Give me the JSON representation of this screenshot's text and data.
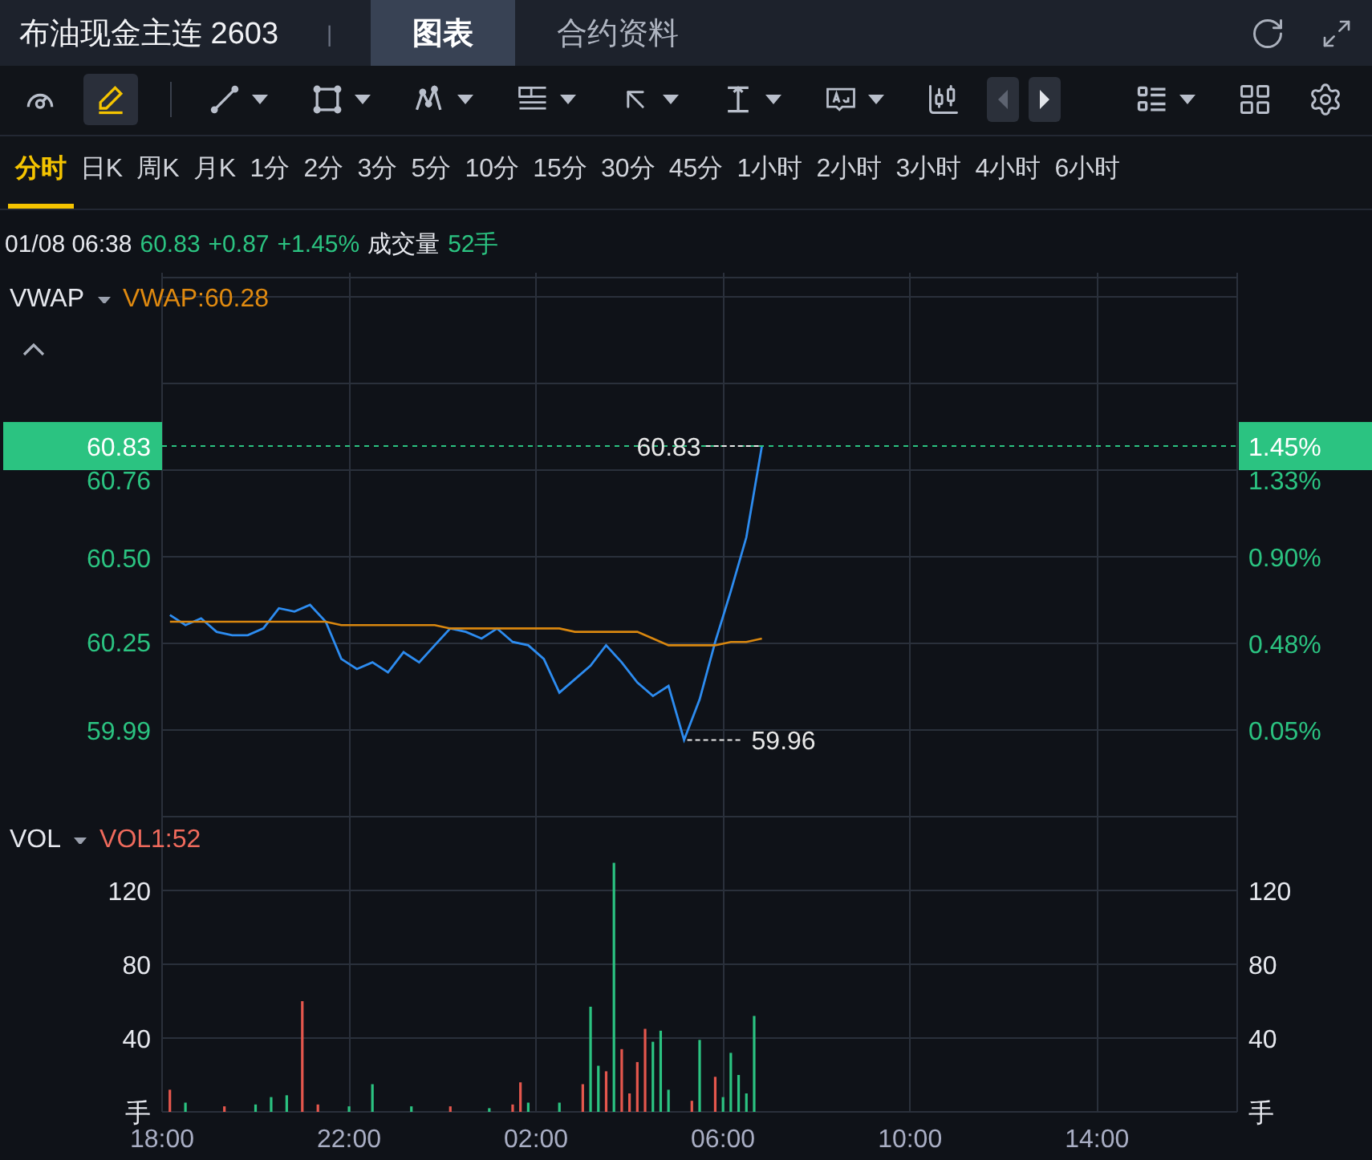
{
  "header": {
    "title": "布油现金主连 2603",
    "separator": "|",
    "tabs": [
      {
        "label": "图表",
        "selected": true
      },
      {
        "label": "合约资料",
        "selected": false
      }
    ]
  },
  "toolbar": {
    "tools": [
      {
        "kind": "gauge",
        "selected": false,
        "dropdown": false
      },
      {
        "kind": "pencil",
        "selected": true,
        "dropdown": false
      },
      {
        "kind": "divider"
      },
      {
        "kind": "line",
        "selected": false,
        "dropdown": true
      },
      {
        "kind": "rectangle",
        "selected": false,
        "dropdown": true
      },
      {
        "kind": "pattern",
        "selected": false,
        "dropdown": true
      },
      {
        "kind": "fib",
        "selected": false,
        "dropdown": true
      },
      {
        "kind": "arrow",
        "selected": false,
        "dropdown": true
      },
      {
        "kind": "measure",
        "selected": false,
        "dropdown": true
      },
      {
        "kind": "textbox",
        "selected": false,
        "dropdown": true
      },
      {
        "kind": "candles",
        "selected": false,
        "dropdown": false
      },
      {
        "kind": "prev",
        "disabled": true
      },
      {
        "kind": "next",
        "disabled": false
      },
      {
        "kind": "spacer"
      },
      {
        "kind": "layout",
        "selected": false,
        "dropdown": true
      },
      {
        "kind": "grid",
        "selected": false,
        "dropdown": false
      },
      {
        "kind": "settings",
        "selected": false,
        "dropdown": false
      }
    ]
  },
  "periods": [
    {
      "label": "分时",
      "selected": true
    },
    {
      "label": "日K",
      "selected": false
    },
    {
      "label": "周K",
      "selected": false
    },
    {
      "label": "月K",
      "selected": false
    },
    {
      "label": "1分",
      "selected": false
    },
    {
      "label": "2分",
      "selected": false
    },
    {
      "label": "3分",
      "selected": false
    },
    {
      "label": "5分",
      "selected": false
    },
    {
      "label": "10分",
      "selected": false
    },
    {
      "label": "15分",
      "selected": false
    },
    {
      "label": "30分",
      "selected": false
    },
    {
      "label": "45分",
      "selected": false
    },
    {
      "label": "1小时",
      "selected": false
    },
    {
      "label": "2小时",
      "selected": false
    },
    {
      "label": "3小时",
      "selected": false
    },
    {
      "label": "4小时",
      "selected": false
    },
    {
      "label": "6小时",
      "selected": false
    }
  ],
  "quote": {
    "time": "01/08 06:38",
    "price": "60.83",
    "change": "+0.87",
    "change_pct": "+1.45%",
    "volume_label": "成交量",
    "volume": "52手"
  },
  "price_panel": {
    "indicator_value": "VWAP:60.28",
    "current_price_tag": "60.83",
    "current_pct_tag": "1.45%",
    "right_axis_labels": [
      "1.33%",
      "0.90%",
      "0.48%",
      "0.05%"
    ],
    "chart_data": {
      "type": "line",
      "grid": true,
      "categories": [
        null,
        null,
        null,
        null,
        null,
        null,
        null,
        null,
        null,
        null,
        null,
        null,
        null,
        null,
        null,
        null,
        null,
        null,
        null,
        null,
        null,
        null,
        null,
        null,
        null,
        null,
        null,
        null,
        null,
        null,
        null,
        null,
        null,
        null,
        null,
        null,
        null,
        null,
        null,
        null,
        null,
        null,
        null,
        null,
        null,
        null,
        null,
        null,
        null,
        null,
        null,
        null,
        null,
        null,
        null,
        null,
        null,
        null,
        null,
        null,
        null,
        null,
        null,
        null,
        null,
        null,
        null,
        null,
        null
      ],
      "series": [
        {
          "color": "#2d8cf0",
          "values": [
            60.33,
            60.3,
            60.32,
            60.28,
            60.27,
            60.27,
            60.29,
            60.35,
            60.34,
            60.36,
            60.31,
            60.2,
            60.17,
            60.19,
            60.16,
            60.22,
            60.19,
            60.24,
            60.29,
            60.28,
            60.26,
            60.29,
            60.25,
            60.24,
            60.2,
            60.1,
            60.14,
            60.18,
            60.24,
            60.19,
            60.13,
            60.09,
            60.12,
            59.96,
            60.08,
            60.25,
            60.4,
            60.56,
            60.83,
            null,
            null,
            null,
            null,
            null,
            null,
            null,
            null,
            null,
            null,
            null,
            null,
            null,
            null,
            null,
            null,
            null,
            null,
            null,
            null,
            null,
            null,
            null,
            null,
            null,
            null,
            null,
            null,
            null,
            null
          ]
        },
        {
          "name": "VWAP",
          "color": "#d9870f",
          "values": [
            60.31,
            60.31,
            60.31,
            60.31,
            60.31,
            60.31,
            60.31,
            60.31,
            60.31,
            60.31,
            60.31,
            60.3,
            60.3,
            60.3,
            60.3,
            60.3,
            60.3,
            60.3,
            60.29,
            60.29,
            60.29,
            60.29,
            60.29,
            60.29,
            60.29,
            60.29,
            60.28,
            60.28,
            60.28,
            60.28,
            60.28,
            60.26,
            60.24,
            60.24,
            60.24,
            60.24,
            60.25,
            60.25,
            60.26,
            null,
            null,
            null,
            null,
            null,
            null,
            null,
            null,
            null,
            null,
            null,
            null,
            null,
            null,
            null,
            null,
            null,
            null,
            null,
            null,
            null,
            null,
            null,
            null,
            null,
            null,
            null,
            null,
            null,
            null
          ]
        }
      ],
      "ylim": [
        59.752,
        61.343
      ],
      "yticks": [
        {
          "value": 60.76,
          "label": "60.76"
        },
        {
          "value": 60.5,
          "label": "60.50"
        },
        {
          "value": 60.25,
          "label": "60.25"
        },
        {
          "value": 59.99,
          "label": "59.99"
        }
      ],
      "ref_lines": [
        {
          "axis": "y",
          "value": 60.83,
          "color": "#2bc381"
        }
      ],
      "annotations": [
        "60.83",
        "59.96"
      ]
    }
  },
  "volume_panel": {
    "indicator": "VOL",
    "indicator_value": "VOL1:52",
    "unit_left": "手",
    "unit_right": "手",
    "right_axis_labels": [
      "120",
      "80",
      "40"
    ],
    "chart_data": {
      "type": "bar",
      "grid": true,
      "categories": [
        "18:00",
        null,
        null,
        null,
        null,
        null,
        null,
        null,
        null,
        null,
        null,
        null,
        null,
        null,
        null,
        null,
        null,
        null,
        null,
        null,
        null,
        null,
        null,
        null,
        "22:00",
        null,
        null,
        null,
        null,
        null,
        null,
        null,
        null,
        null,
        null,
        null,
        null,
        null,
        null,
        null,
        null,
        null,
        null,
        null,
        null,
        null,
        null,
        null,
        "02:00",
        null,
        null,
        null,
        null,
        null,
        null,
        null,
        null,
        null,
        null,
        null,
        null,
        null,
        null,
        null,
        null,
        null,
        null,
        null,
        null,
        null,
        null,
        null,
        "06:00",
        null,
        null,
        null,
        null,
        null,
        null,
        null,
        null,
        null,
        null,
        null,
        null,
        null,
        null,
        null,
        null,
        null,
        null,
        null,
        null,
        null,
        null,
        null,
        "10:00",
        null,
        null,
        null,
        null,
        null,
        null,
        null,
        null,
        null,
        null,
        null,
        null,
        null,
        null,
        null,
        null,
        null,
        null,
        null,
        null,
        null,
        null,
        null,
        "14:00",
        null,
        null,
        null,
        null,
        null,
        null,
        null,
        null,
        null,
        null,
        null,
        null,
        null,
        null,
        null,
        null,
        null
      ],
      "series": [
        {
          "color": "#2bc381",
          "values": [
            null,
            null,
            null,
            5,
            null,
            null,
            null,
            null,
            null,
            null,
            null,
            null,
            4,
            null,
            8,
            null,
            9,
            null,
            null,
            null,
            null,
            null,
            null,
            null,
            3,
            null,
            null,
            15,
            null,
            null,
            null,
            null,
            3,
            null,
            null,
            null,
            null,
            null,
            null,
            null,
            null,
            null,
            2,
            null,
            null,
            null,
            null,
            5,
            null,
            null,
            null,
            5,
            null,
            null,
            null,
            57,
            25,
            null,
            135,
            null,
            null,
            null,
            null,
            38,
            44,
            12,
            null,
            null,
            null,
            39,
            null,
            null,
            8,
            32,
            20,
            10,
            52,
            null,
            null,
            null,
            null,
            null,
            null,
            null,
            null,
            null,
            null,
            null,
            null,
            null,
            null,
            null,
            null,
            null,
            null,
            null,
            null,
            null,
            null,
            null,
            null,
            null,
            null,
            null,
            null,
            null,
            null,
            null,
            null,
            null,
            null,
            null,
            null,
            null,
            null,
            null,
            null,
            null,
            null,
            null,
            null,
            null,
            null,
            null,
            null,
            null,
            null,
            null,
            null,
            null,
            null,
            null,
            null,
            null,
            null,
            null,
            null,
            null
          ]
        },
        {
          "color": "#e5574d",
          "values": [
            null,
            12,
            null,
            null,
            null,
            null,
            null,
            null,
            3,
            null,
            null,
            null,
            null,
            null,
            null,
            null,
            null,
            null,
            60,
            null,
            4,
            null,
            null,
            null,
            null,
            null,
            null,
            null,
            null,
            null,
            null,
            null,
            null,
            null,
            null,
            null,
            null,
            3,
            null,
            null,
            null,
            null,
            null,
            null,
            null,
            4,
            16,
            null,
            null,
            null,
            null,
            null,
            null,
            null,
            15,
            null,
            null,
            22,
            null,
            34,
            10,
            27,
            45,
            null,
            null,
            null,
            null,
            null,
            6,
            null,
            null,
            19,
            null,
            null,
            null,
            null,
            null,
            null,
            null,
            null,
            null,
            null,
            null,
            null,
            null,
            null,
            null,
            null,
            null,
            null,
            null,
            null,
            null,
            null,
            null,
            null,
            null,
            null,
            null,
            null,
            null,
            null,
            null,
            null,
            null,
            null,
            null,
            null,
            null,
            null,
            null,
            null,
            null,
            null,
            null,
            null,
            null,
            null,
            null,
            null,
            null,
            null,
            null,
            null,
            null,
            null,
            null,
            null,
            null,
            null,
            null,
            null,
            null,
            null,
            null,
            null,
            null,
            null
          ]
        }
      ],
      "stacked": false,
      "ylim": [
        0,
        163.5
      ],
      "yticks": [
        {
          "value": 120,
          "label": "120"
        },
        {
          "value": 80,
          "label": "80"
        },
        {
          "value": 40,
          "label": "40"
        }
      ]
    }
  }
}
